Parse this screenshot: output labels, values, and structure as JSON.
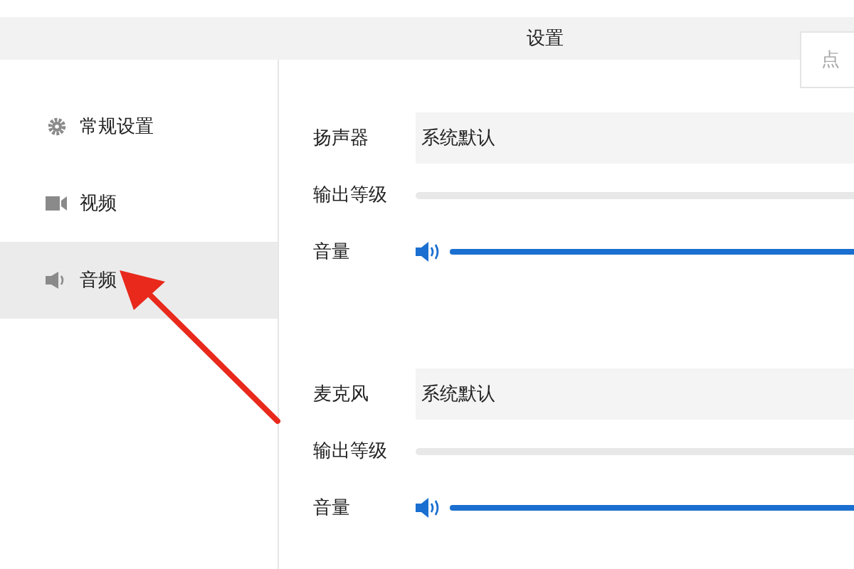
{
  "window": {
    "title": "设置"
  },
  "top_button": {
    "label": "点"
  },
  "sidebar": {
    "items": [
      {
        "label": "常规设置",
        "kind": "gear",
        "selected": false
      },
      {
        "label": "视频",
        "kind": "camera",
        "selected": false
      },
      {
        "label": "音频",
        "kind": "speaker",
        "selected": true
      }
    ]
  },
  "sections": [
    {
      "device_label": "扬声器",
      "device_value": "系统默认",
      "level_label": "输出等级",
      "volume_label": "音量",
      "volume": {
        "level": 1
      }
    },
    {
      "device_label": "麦克风",
      "device_value": "系统默认",
      "level_label": "输出等级",
      "volume_label": "音量",
      "volume": {
        "level": 1
      }
    }
  ]
}
